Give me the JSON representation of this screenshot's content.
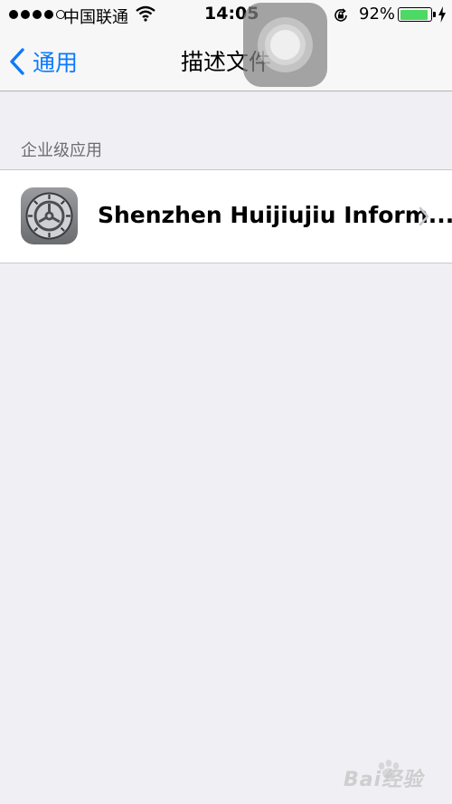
{
  "status_bar": {
    "carrier": "中国联通",
    "time": "14:05",
    "battery_percent": "92%",
    "battery_level": 0.92,
    "signal_bars_filled": 4,
    "signal_bars_total": 5,
    "battery_color": "#4cd964"
  },
  "nav": {
    "back_label": "通用",
    "title": "描述文件",
    "accent_color": "#0a7aff"
  },
  "section": {
    "header": "企业级应用",
    "items": [
      {
        "label": "Shenzhen Huijiujiu Inform...",
        "icon": "settings-gear-icon"
      }
    ]
  },
  "watermark": {
    "text": "Bai经验"
  }
}
